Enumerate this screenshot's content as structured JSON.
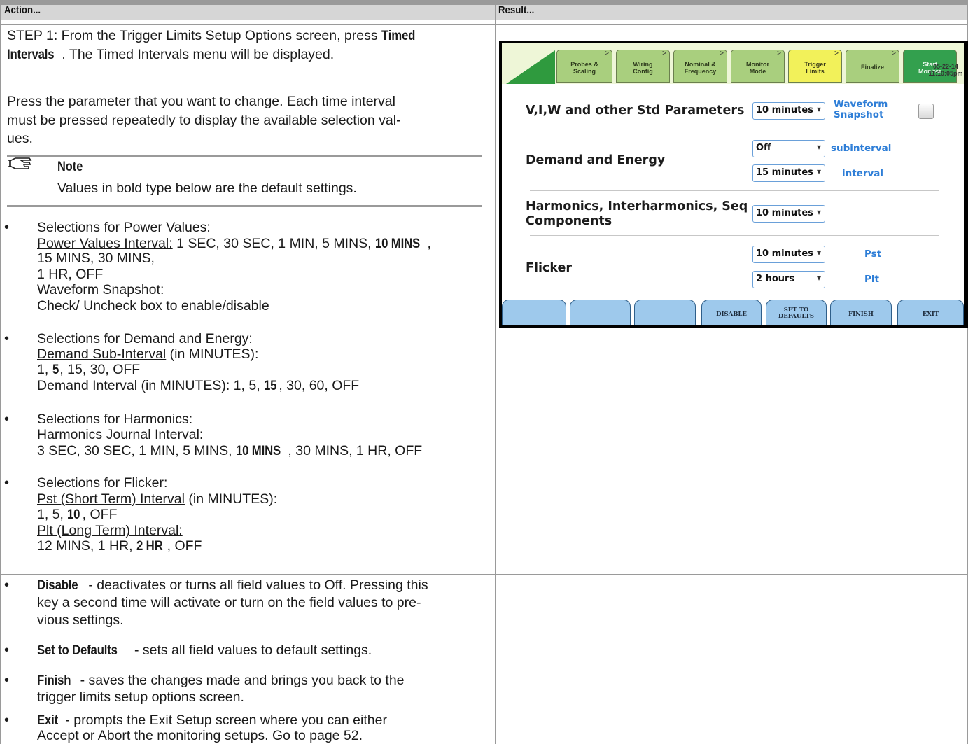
{
  "header": {
    "left": "Action...",
    "right": "Result..."
  },
  "step1": {
    "line1_pre": "STEP 1: From the Trigger Limits Setup Options screen, press ",
    "line1_bold": "Timed",
    "line2_bold": "Intervals",
    "line2_post": ". The Timed Intervals menu will be displayed."
  },
  "press_param": [
    "Press the parameter that you want to change. Each time interval",
    "must be pressed repeatedly to display the available selection val-",
    "ues."
  ],
  "note": {
    "title": "Note",
    "body": "Values in bold type below are the default settings."
  },
  "power": {
    "heading": "Selections for Power Values:",
    "interval_label": "Power Values Interval:",
    "interval_pre": " 1 SEC, 30 SEC, 1 MIN, 5 MINS, ",
    "interval_bold": "10 MINS",
    "interval_post": ",",
    "line2": "15 MINS, 30 MINS,",
    "line3": "1 HR, OFF",
    "snapshot_label": "Waveform Snapshot:",
    "snapshot_text": "Check/ Uncheck box to enable/disable"
  },
  "demand": {
    "heading": "Selections for Demand and Energy:",
    "sub_label": "Demand Sub-Interval",
    "sub_unit": " (in MINUTES):",
    "sub_pre": "1, ",
    "sub_bold": "5",
    "sub_post": ", 15, 30, OFF",
    "int_label": "Demand Interval",
    "int_pre": " (in MINUTES): 1, 5, ",
    "int_bold": "15",
    "int_post": ", 30, 60, OFF"
  },
  "harmonics": {
    "heading": "Selections for Harmonics:",
    "label": "Harmonics Journal Interval:",
    "pre": "3 SEC, 30 SEC, 1 MIN, 5 MINS, ",
    "bold": "10 MINS",
    "post": ", 30 MINS, 1 HR, OFF"
  },
  "flicker": {
    "heading": "Selections for Flicker:",
    "pst_label": "Pst (Short Term) Interval",
    "pst_unit": " (in MINUTES):",
    "pst_pre": "1, 5, ",
    "pst_bold": "10",
    "pst_post": ", OFF",
    "plt_label": "Plt (Long Term) Interval:",
    "plt_pre": "12 MINS, 1 HR, ",
    "plt_bold": "2 HR",
    "plt_post": ", OFF"
  },
  "buttons_desc": {
    "disable_bold": "Disable",
    "disable_l1": " - deactivates or turns all field values to Off. Pressing this",
    "disable_l2": "key a second time will activate or turn on the field values to pre-",
    "disable_l3": "vious settings.",
    "defaults_bold": "Set to Defaults",
    "defaults_text": " - sets all field values to default settings.",
    "finish_bold": "Finish",
    "finish_l1": " - saves the changes made and brings you back to the",
    "finish_l2": "trigger limits setup options screen.",
    "exit_bold": "Exit",
    "exit_l1": " - prompts the Exit Setup screen where you can either",
    "exit_l2": "Accept or Abort the monitoring setups. Go to page 52."
  },
  "device": {
    "tabs": [
      {
        "l1": "Probes &",
        "l2": "Scaling"
      },
      {
        "l1": "Wiring",
        "l2": "Config"
      },
      {
        "l1": "Nominal &",
        "l2": "Frequency"
      },
      {
        "l1": "Monitor",
        "l2": "Mode"
      },
      {
        "l1": "Trigger",
        "l2": "Limits"
      },
      {
        "l1": "Finalize",
        "l2": ""
      },
      {
        "l1": "Start",
        "l2": "Monitor"
      }
    ],
    "tab_arrow": ">",
    "date": "05-22-14",
    "time": "11:10:05pm",
    "rows": {
      "vi_label": "V,I,W and other Std Parameters",
      "vi_value": "10 minutes",
      "waveform_l1": "Waveform",
      "waveform_l2": "Snapshot",
      "demand_label": "Demand and Energy",
      "demand_sub_value": "Off",
      "demand_sub_lbl": "subinterval",
      "demand_int_value": "15 minutes",
      "demand_int_lbl": "interval",
      "harm_l1": "Harmonics, Interharmonics, Seq",
      "harm_l2": "Components",
      "harm_value": "10 minutes",
      "flicker_label": "Flicker",
      "pst_value": "10 minutes",
      "pst_lbl": "Pst",
      "plt_value": "2 hours",
      "plt_lbl": "Plt"
    },
    "caret": "▾",
    "softkeys": [
      "",
      "",
      "",
      "DISABLE",
      "SET TO DEFAULTS",
      "FINISH",
      "EXIT"
    ],
    "softkey_l1": "SET TO",
    "softkey_l2": "DEFAULTS"
  }
}
